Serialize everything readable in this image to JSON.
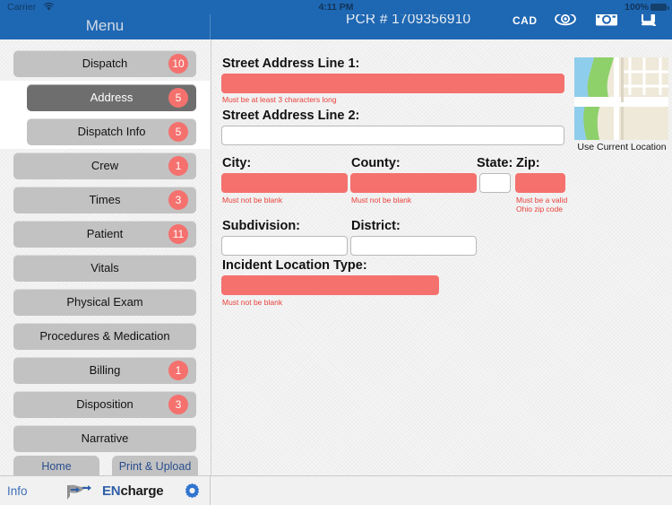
{
  "statusbar": {
    "carrier": "Carrier",
    "wifi_icon": "wifi-icon",
    "time": "4:11 PM",
    "battery_percent": "100%",
    "battery_icon": "battery-full-icon"
  },
  "menu_header": {
    "title": "Menu"
  },
  "main_header": {
    "pcr_label": "PCR # 1709356910",
    "cad_label": "CAD",
    "eye_icon": "eye-icon",
    "camera_icon": "camera-icon",
    "device_icon": "device-monitor-icon"
  },
  "sidebar": {
    "items": [
      {
        "label": "Dispatch",
        "badge": "10",
        "selected": false,
        "sub": false
      },
      {
        "label": "Address",
        "badge": "5",
        "selected": true,
        "sub": true
      },
      {
        "label": "Dispatch Info",
        "badge": "5",
        "selected": false,
        "sub": true
      },
      {
        "label": "Crew",
        "badge": "1",
        "selected": false,
        "sub": false
      },
      {
        "label": "Times",
        "badge": "3",
        "selected": false,
        "sub": false
      },
      {
        "label": "Patient",
        "badge": "11",
        "selected": false,
        "sub": false
      },
      {
        "label": "Vitals",
        "badge": "",
        "selected": false,
        "sub": false
      },
      {
        "label": "Physical Exam",
        "badge": "",
        "selected": false,
        "sub": false
      },
      {
        "label": "Procedures & Medication",
        "badge": "",
        "selected": false,
        "sub": false
      },
      {
        "label": "Billing",
        "badge": "1",
        "selected": false,
        "sub": false
      },
      {
        "label": "Disposition",
        "badge": "3",
        "selected": false,
        "sub": false
      },
      {
        "label": "Narrative",
        "badge": "",
        "selected": false,
        "sub": false
      }
    ],
    "home_label": "Home",
    "print_label": "Print & Upload"
  },
  "bottombar": {
    "info_label": "Info",
    "brand_prefix": "EN",
    "brand_suffix": "charge",
    "brand_logo_icon": "encharge-flag-logo-icon",
    "gear_icon": "gear-icon"
  },
  "form": {
    "street1": {
      "label": "Street Address Line 1:",
      "value": "",
      "placeholder": "",
      "error": "Must be at least 3 characters long",
      "invalid": true
    },
    "street2": {
      "label": "Street Address  Line 2:",
      "value": "",
      "placeholder": "",
      "error": "",
      "invalid": false
    },
    "city": {
      "label": "City:",
      "value": "",
      "placeholder": "",
      "error": "Must not be blank",
      "invalid": true
    },
    "county": {
      "label": "County:",
      "value": "",
      "placeholder": "",
      "error": "Must not be blank",
      "invalid": true
    },
    "state": {
      "label": "State:",
      "value": "",
      "placeholder": "",
      "error": "",
      "invalid": false
    },
    "zip": {
      "label": "Zip:",
      "value": "",
      "placeholder": "",
      "error": "Must be a valid\nOhio zip code",
      "invalid": true
    },
    "subdivision": {
      "label": "Subdivision:",
      "value": "",
      "placeholder": "",
      "error": "",
      "invalid": false
    },
    "district": {
      "label": "District:",
      "value": "",
      "placeholder": "",
      "error": "",
      "invalid": false
    },
    "incident_location_type": {
      "label": "Incident Location Type:",
      "value": "",
      "placeholder": "",
      "error": "Must not be blank",
      "invalid": true
    }
  },
  "map": {
    "caption": "Use Current Location",
    "thumbnail_icon": "map-thumbnail-icon"
  },
  "colors": {
    "header_blue": "#1e67b3",
    "error_red": "#f4716e",
    "error_text": "#e8413c",
    "menu_gray": "#c2c2c2",
    "menu_selected_gray": "#6e6e6e",
    "link_blue": "#2b4e8f"
  }
}
